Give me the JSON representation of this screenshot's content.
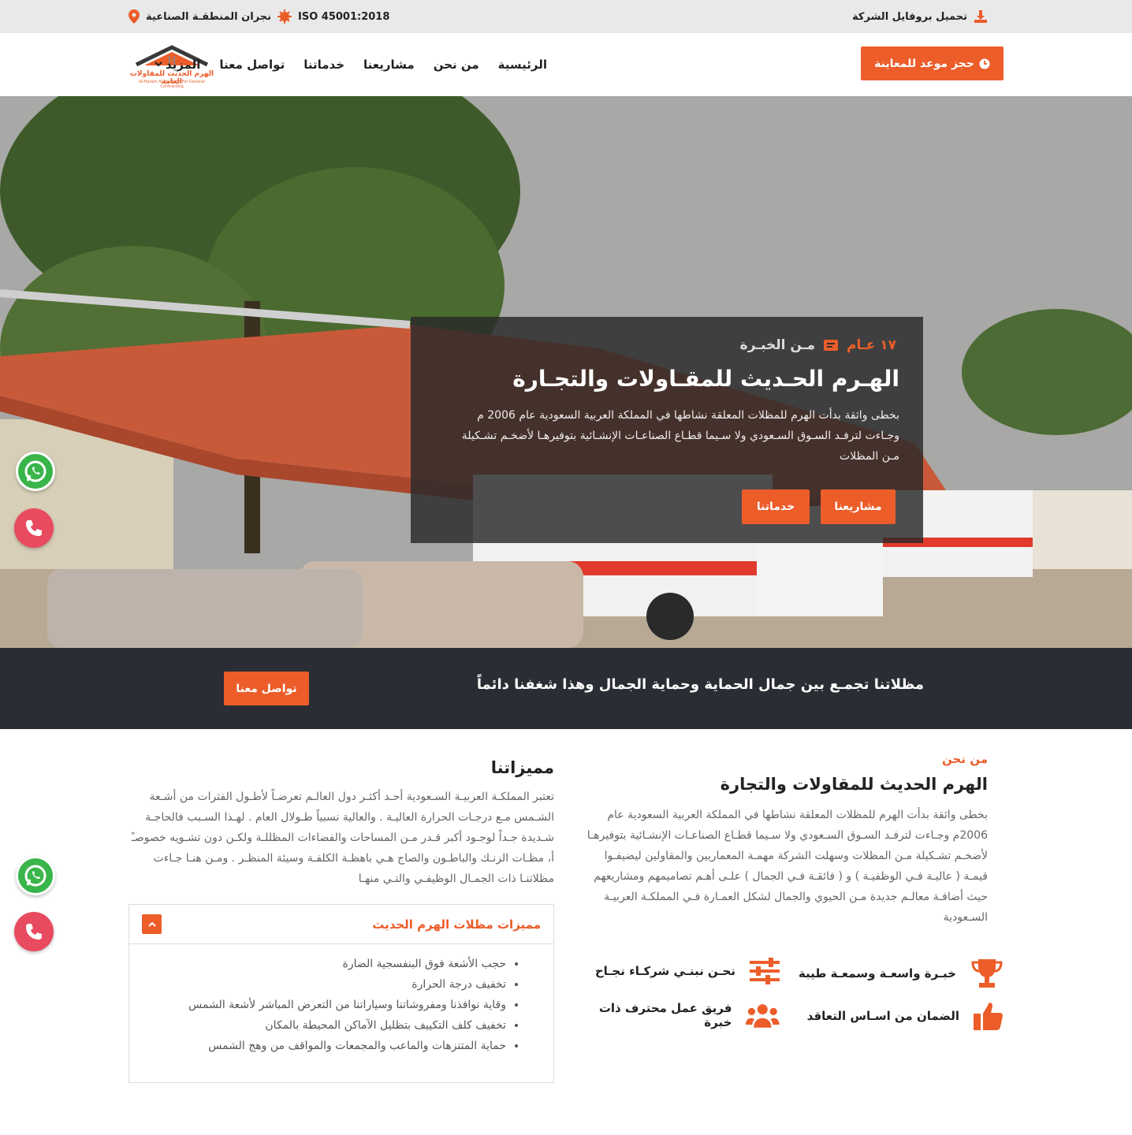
{
  "colors": {
    "accent": "#ec5d2a",
    "dark_strip": "#2a2d34",
    "whatsapp": "#39b54a",
    "phone": "#e84a5f"
  },
  "topbar": {
    "download_label": "تحميل بروفايل الشركة",
    "iso_label": "ISO 45001:2018",
    "location_label": "نجران المنطقـة الصناعية"
  },
  "header": {
    "logo_ar": "الهرم الحديث للمقاولات العامة",
    "logo_en": "Al-Haram Al-Hadeeth For General Contracting",
    "nav": [
      {
        "label": "الرئيسية"
      },
      {
        "label": "من نحن"
      },
      {
        "label": "مشاريعنا"
      },
      {
        "label": "خدماتنا"
      },
      {
        "label": "تواصل معنا"
      },
      {
        "label": "المزيد"
      }
    ],
    "book_label": "حجز موعد للمعاينة"
  },
  "hero": {
    "years": "١٧ عـام",
    "years_suffix": "مـن الخبـرة",
    "title": "الهـرم الحـديث للمقـاولات والتجـارة",
    "description": "بخطى واثقة بدأت الهرم للمظلات المعلقة نشاطها في المملكة العربية السعودية عام 2006 م وجـاءت لترفـد السـوق السـعودي ولا سـيما قطـاع الصناعـات الإنشـائية بتوفيرهـا لأضخـم تشـكيلة مـن المظلات",
    "btn_projects": "مشاريعنا",
    "btn_services": "خدماتنا"
  },
  "strip": {
    "text": "مظلاتنا تجمـع بين جمال الحماية وحماية الجمال وهذا شغفنا دائماً",
    "button": "تواصل معنا"
  },
  "about": {
    "kicker": "من نحن",
    "title": "الهرم الحديث للمقاولات والتجارة",
    "text": "بخطى واثقة بدأت الهرم للمظلات المعلقة نشاطها في المملكة العربية السعودية عام 2006م وجـاءت لترفـد السـوق السـعودي ولا سـيما قطـاع الصناعـات الإنشـائية بتوفيرهـا لأضخـم تشـكيلة مـن المظلات وسهلت الشركة مهمـة المعماريين والمقاولين ليضيفـوا قيمـة ( عاليـة فـي الوظفيـة ) و ( فائقـة فـي الجمال ) علـى أهـم تصاميمهم ومشاريعهم حيث أضافـة معالـم جديدة مـن الحيوي والجمال لشكل العمـارة فـي المملكـة العربيـة السـعودية",
    "features": [
      {
        "label": "خبـرة واسعـة وسمعـة طيبة",
        "icon": "trophy-icon"
      },
      {
        "label": "نحـن نبنـي شركـاء نجـاح",
        "icon": "sliders-icon"
      },
      {
        "label": "الضمان من اسـاس التعاقد",
        "icon": "thumbs-up-icon"
      },
      {
        "label": "فريق عمل محترف ذات خبرة",
        "icon": "team-icon"
      }
    ]
  },
  "features": {
    "title": "مميزاتنا",
    "text": "تعتبر المملكـة العربيـة السـعودية أحـد أكثـر دول العالـم تعرضـاً لأطـول الفترات من أشـعة الشـمس مـع درجـات الحرارة العاليـة . والعالية نسبياً طـولال العام . لهـذا السـبب فالحاجـة شـديدة جـداً لوجـود أكبر قـدر مـن المساحات والفضاءات المظللـة ولكـن دون تشـويه خصوصـً أ، مظـات الزنـك والباطـون والصاج هـي باهظـة الكلفـة وسيئة المنظـر . ومـن هنـا جـاءت مظلاتنـا ذات الجمـال الوظيفـي والتـي منهـا",
    "accordion_title": "مميزات مظلات الهرم الحديث",
    "items": [
      "حجب الأشعة فوق البنفسجية الضارة",
      "تخفيف درجة الحرارة",
      "وقاية نوافذنا ومفروشاتنا وسياراتنا من التعرض المباشر لأشعة الشمس",
      "تخفيف كلف التكييف بتظليل الآماكن المحيطة بالمكان",
      "حماية المتنزهات والماعب والمجمعات والمواقف من وهج الشمس"
    ]
  }
}
